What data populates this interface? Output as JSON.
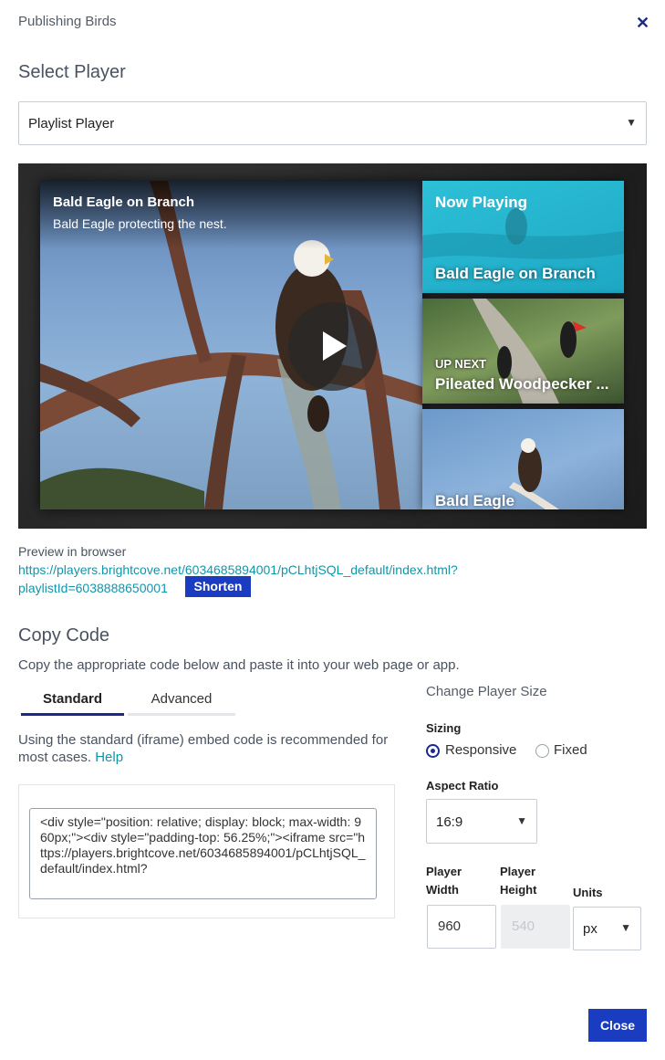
{
  "header": {
    "title": "Publishing Birds",
    "close_icon": "close-icon"
  },
  "select_player": {
    "title": "Select Player",
    "value": "Playlist Player",
    "caret": "▼"
  },
  "preview_player": {
    "video_title": "Bald Eagle on Branch",
    "video_description": "Bald Eagle protecting the nest.",
    "playlist": [
      {
        "top_label": "Now Playing",
        "title": "Bald Eagle on Branch"
      },
      {
        "top_label": "UP NEXT",
        "title": "Pileated Woodpecker ..."
      },
      {
        "title": "Bald Eagle"
      }
    ]
  },
  "preview": {
    "label": "Preview in browser",
    "url": "https://players.brightcove.net/6034685894001/pCLhtjSQL_default/index.html?playlistId=6038888650001",
    "shorten_label": "Shorten"
  },
  "copy_code": {
    "title": "Copy Code",
    "description": "Copy the appropriate code below and paste it into your web page or app.",
    "tabs": [
      {
        "label": "Standard",
        "active": true
      },
      {
        "label": "Advanced",
        "active": false
      }
    ],
    "standard_description": "Using the standard (iframe) embed code is recommended for most cases.",
    "help_label": "Help",
    "code": "<div style=\"position: relative; display: block; max-width: 960px;\"><div style=\"padding-top: 56.25%;\"><iframe src=\"https://players.brightcove.net/6034685894001/pCLhtjSQL_default/index.html?"
  },
  "player_size": {
    "title": "Change Player Size",
    "sizing_label": "Sizing",
    "sizing_options": [
      {
        "label": "Responsive",
        "selected": true
      },
      {
        "label": "Fixed",
        "selected": false
      }
    ],
    "aspect_ratio_label": "Aspect Ratio",
    "aspect_ratio_value": "16:9",
    "player_width_label": "Player Width",
    "player_width_value": "960",
    "player_height_label": "Player Height",
    "player_height_value": "540",
    "units_label": "Units",
    "units_value": "px"
  },
  "footer": {
    "close_label": "Close"
  },
  "colors": {
    "accent": "#1a3cc0",
    "link": "#1196a9",
    "close_x": "#1a2a8c"
  }
}
